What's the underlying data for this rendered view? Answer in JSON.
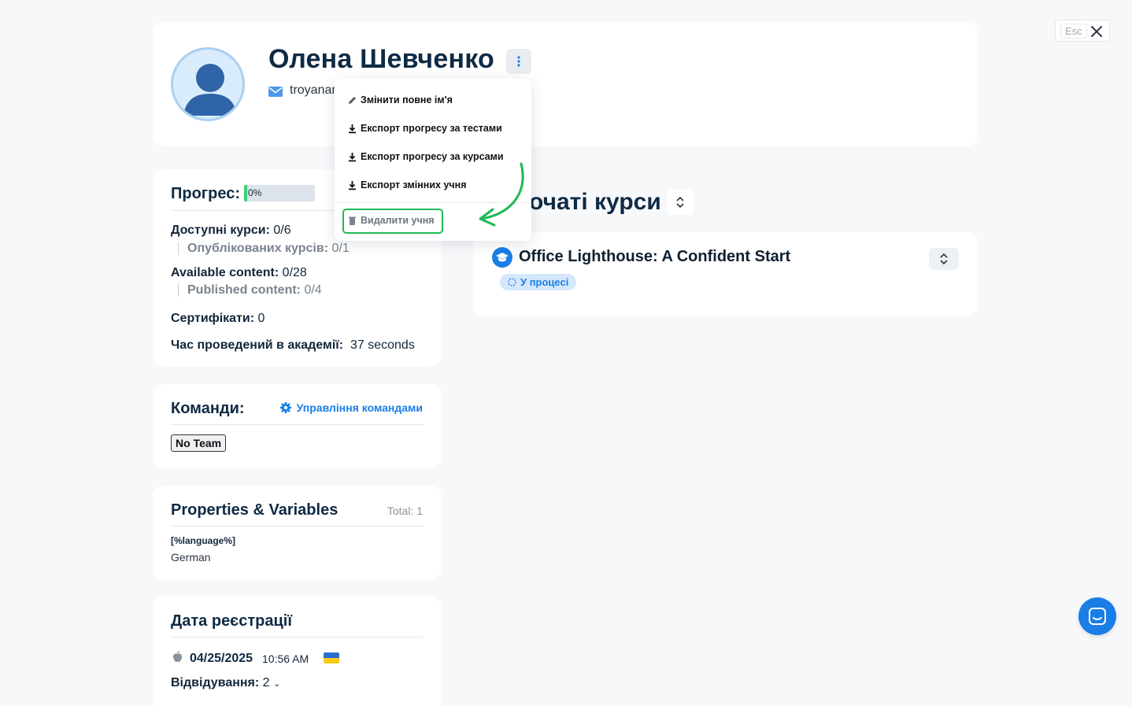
{
  "close": {
    "esc_label": "Esc"
  },
  "profile": {
    "name": "Олена Шевченко",
    "email": "troyanar"
  },
  "menu": {
    "items": [
      {
        "label": "Змінити повне ім'я",
        "icon": "pencil-icon"
      },
      {
        "label": "Експорт прогресу за тестами",
        "icon": "download-icon"
      },
      {
        "label": "Експорт прогресу за курсами",
        "icon": "download-icon"
      },
      {
        "label": "Експорт змінних учня",
        "icon": "download-icon"
      }
    ],
    "danger": {
      "label": "Видалити учня",
      "icon": "trash-icon"
    },
    "highlight_color": "#1db954"
  },
  "progress": {
    "title": "Прогрес:",
    "bar_label": "0%",
    "bar_value": 0,
    "available_courses_label": "Доступні курси:",
    "available_courses_value": "0/6",
    "published_courses_label": "Опублікованих курсів:",
    "published_courses_value": "0/1",
    "available_content_label": "Available content:",
    "available_content_value": "0/28",
    "published_content_label": "Published content:",
    "published_content_value": "0/4",
    "certificates_label": "Сертифікати:",
    "certificates_value": "0",
    "time_label": "Час проведений в академії:",
    "time_value": "37 seconds"
  },
  "teams": {
    "title": "Команди:",
    "manage_label": "Управління командами",
    "badge": "No Team"
  },
  "properties": {
    "title": "Properties & Variables",
    "total": "Total: 1",
    "key": "[%language%]",
    "value": "German"
  },
  "registration": {
    "title": "Дата реєстрації",
    "date": "04/25/2025",
    "time": "10:56 AM",
    "visits_label": "Відвідування:",
    "visits_value": "2"
  },
  "courses": {
    "title": "очаті курси",
    "items": [
      {
        "name": "Office Lighthouse: A Confident Start",
        "status": "У процесі"
      }
    ]
  },
  "colors": {
    "accent": "#1a7ee6",
    "progress_fill": "#3ccf7a",
    "ukraine_blue": "#2a6dd0",
    "ukraine_yellow": "#f7cb1a"
  }
}
